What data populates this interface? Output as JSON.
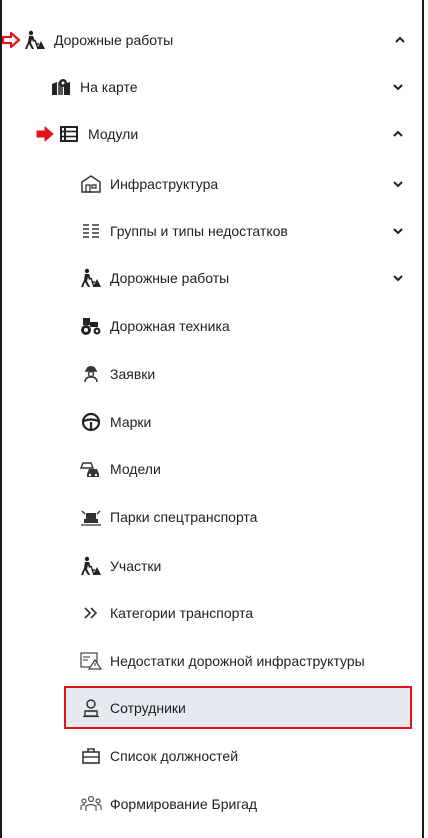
{
  "menu": {
    "road_works": {
      "label": "Дорожные работы",
      "icon": "road-works-icon",
      "expanded": true
    },
    "on_map": {
      "label": "На карте",
      "icon": "map-icon",
      "expanded": false
    },
    "modules": {
      "label": "Модули",
      "icon": "modules-icon",
      "expanded": true
    },
    "items": [
      {
        "label": "Инфраструктура",
        "icon": "building-icon",
        "has_children": true
      },
      {
        "label": "Группы и типы недостатков",
        "icon": "list-icon",
        "has_children": true
      },
      {
        "label": "Дорожные работы",
        "icon": "road-works-icon",
        "has_children": true
      },
      {
        "label": "Дорожная техника",
        "icon": "tractor-icon",
        "has_children": false
      },
      {
        "label": "Заявки",
        "icon": "worker-icon",
        "has_children": false
      },
      {
        "label": "Марки",
        "icon": "steering-wheel-icon",
        "has_children": false
      },
      {
        "label": "Модели",
        "icon": "cars-icon",
        "has_children": false
      },
      {
        "label": "Парки спецтранспорта",
        "icon": "garage-icon",
        "has_children": false
      },
      {
        "label": "Участки",
        "icon": "road-works-icon",
        "has_children": false
      },
      {
        "label": "Категории транспорта",
        "icon": "double-chevron-icon",
        "has_children": false
      },
      {
        "label": "Недостатки дорожной инфраструктуры",
        "icon": "warning-image-icon",
        "has_children": false
      },
      {
        "label": "Сотрудники",
        "icon": "employee-icon",
        "has_children": false,
        "selected": true
      },
      {
        "label": "Список должностей",
        "icon": "briefcase-icon",
        "has_children": false
      },
      {
        "label": "Формирование Бригад",
        "icon": "team-icon",
        "has_children": false
      }
    ]
  },
  "colors": {
    "accent_arrow": "#e0151e",
    "selected_bg": "#e7e9f1",
    "highlight_border": "#e0151e"
  }
}
